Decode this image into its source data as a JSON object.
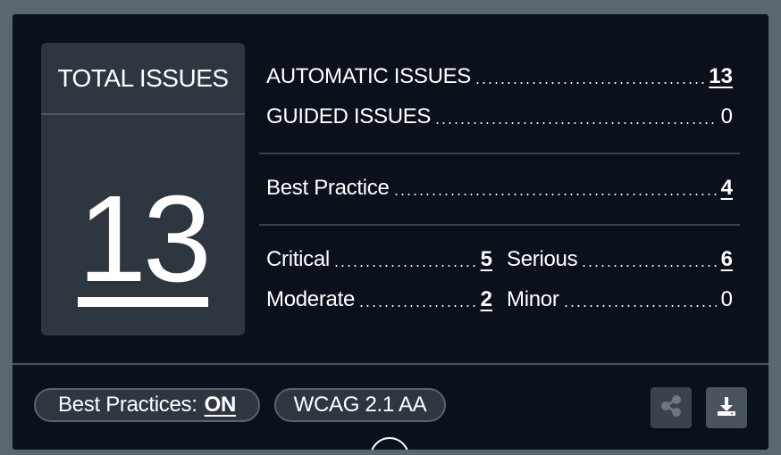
{
  "summary": {
    "total_title": "TOTAL ISSUES",
    "total_count": "13",
    "automatic": {
      "label": "AUTOMATIC ISSUES",
      "value": "13"
    },
    "guided": {
      "label": "GUIDED ISSUES",
      "value": "0"
    },
    "best_practice": {
      "label": "Best Practice",
      "value": "4"
    },
    "critical": {
      "label": "Critical",
      "value": "5"
    },
    "serious": {
      "label": "Serious",
      "value": "6"
    },
    "moderate": {
      "label": "Moderate",
      "value": "2"
    },
    "minor": {
      "label": "Minor",
      "value": "0"
    }
  },
  "footer": {
    "best_practices_label": "Best Practices:",
    "best_practices_state": "ON",
    "standard": "WCAG 2.1 AA",
    "share_icon": "share-icon",
    "download_icon": "download-icon"
  },
  "colors": {
    "page_bg": "#5b6670",
    "panel_bg": "#0a111a",
    "card_bg": "#2e3740",
    "text": "#ffffff"
  }
}
